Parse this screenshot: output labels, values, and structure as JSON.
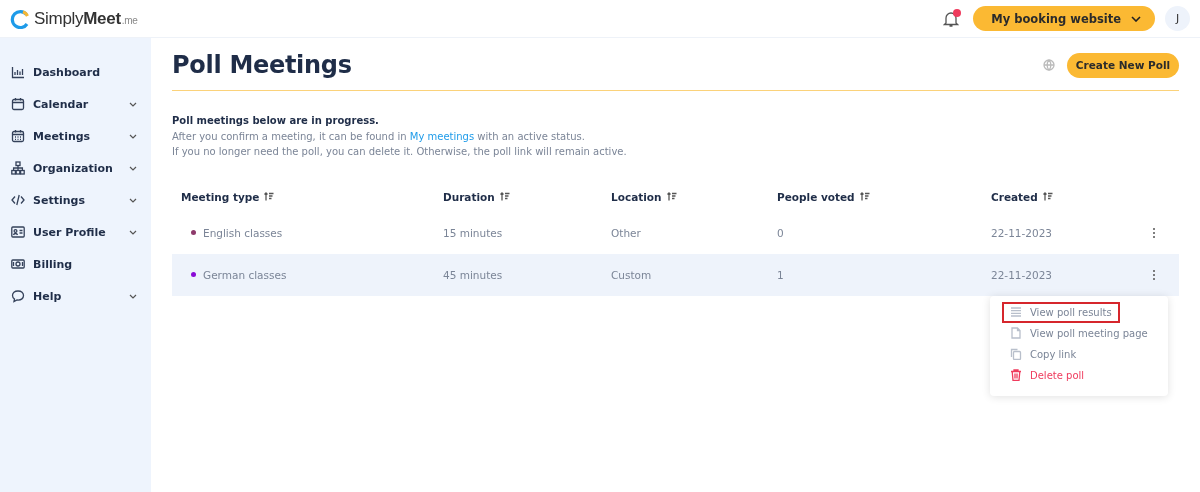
{
  "header": {
    "logo": {
      "brand": "Simply",
      "brand_bold": "Meet",
      "suffix": ".me"
    },
    "notifications": {
      "unread": true
    },
    "booking_button": "My booking website",
    "avatar": "J"
  },
  "sidebar": {
    "items": [
      {
        "label": "Dashboard",
        "kind": "dashboard",
        "expandable": false
      },
      {
        "label": "Calendar",
        "kind": "calendar",
        "expandable": true
      },
      {
        "label": "Meetings",
        "kind": "meetings",
        "expandable": true
      },
      {
        "label": "Organization",
        "kind": "organization",
        "expandable": true
      },
      {
        "label": "Settings",
        "kind": "code",
        "expandable": true
      },
      {
        "label": "User Profile",
        "kind": "profile",
        "expandable": true
      },
      {
        "label": "Billing",
        "kind": "billing",
        "expandable": false
      },
      {
        "label": "Help",
        "kind": "help",
        "expandable": true
      }
    ]
  },
  "page": {
    "title": "Poll Meetings",
    "create_button": "Create New Poll",
    "intro": {
      "heading": "Poll meetings below are in progress.",
      "line1_before": "After you confirm a meeting, it can be found in",
      "line1_link": "My meetings",
      "line1_after": "with an active status.",
      "line2": "If you no longer need the poll, you can delete it. Otherwise, the poll link will remain active."
    }
  },
  "table": {
    "columns": [
      "Meeting type",
      "Duration",
      "Location",
      "People voted",
      "Created"
    ],
    "rows": [
      {
        "selected": false,
        "color": "#8e3a6b",
        "cells": [
          "English classes",
          "15 minutes",
          "Other",
          "0",
          "22-11-2023"
        ]
      },
      {
        "selected": true,
        "color": "#8a0bd6",
        "cells": [
          "German classes",
          "45 minutes",
          "Custom",
          "1",
          "22-11-2023"
        ]
      }
    ]
  },
  "row_menu": {
    "items": [
      {
        "label": "View poll results",
        "kind": "results",
        "outlined": true
      },
      {
        "label": "View poll meeting page",
        "kind": "page",
        "outlined": false
      },
      {
        "label": "Copy link",
        "kind": "copy",
        "outlined": false
      },
      {
        "label": "Delete poll",
        "kind": "delete",
        "outlined": false
      }
    ]
  }
}
